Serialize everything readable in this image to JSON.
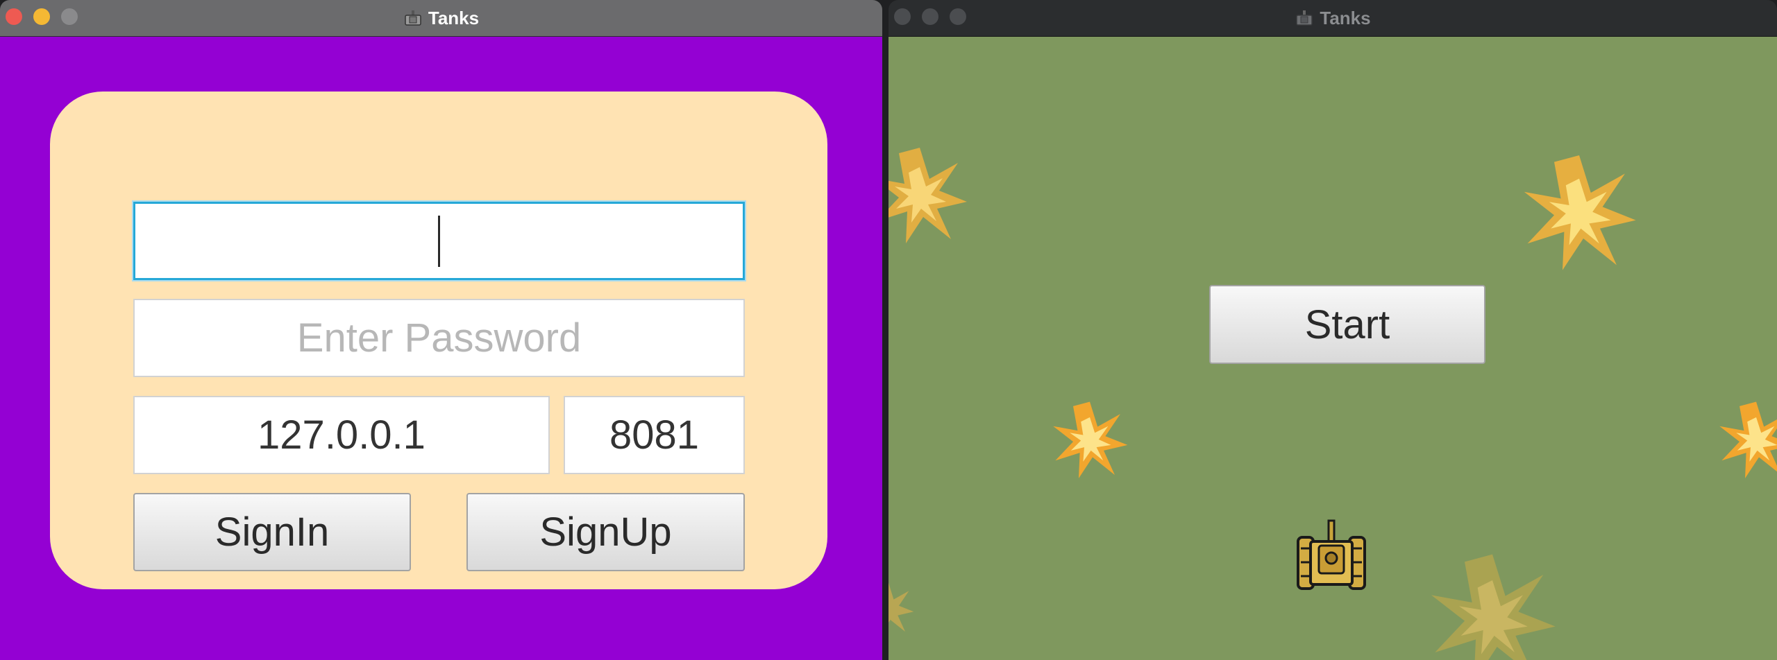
{
  "login_window": {
    "title": "Tanks",
    "title_icon": "tank-icon",
    "background_color": "#9401d3",
    "card_color": "#ffe3b3",
    "username": {
      "value": "",
      "placeholder": ""
    },
    "password": {
      "value": "",
      "placeholder": "Enter Password"
    },
    "host": {
      "value": "127.0.0.1"
    },
    "port": {
      "value": "8081"
    },
    "signin_label": "SignIn",
    "signup_label": "SignUp"
  },
  "game_window": {
    "title": "Tanks",
    "title_icon": "tank-icon",
    "background_color": "#7f985e",
    "start_label": "Start",
    "decorations": [
      "explosion-icon",
      "tank-icon"
    ]
  }
}
